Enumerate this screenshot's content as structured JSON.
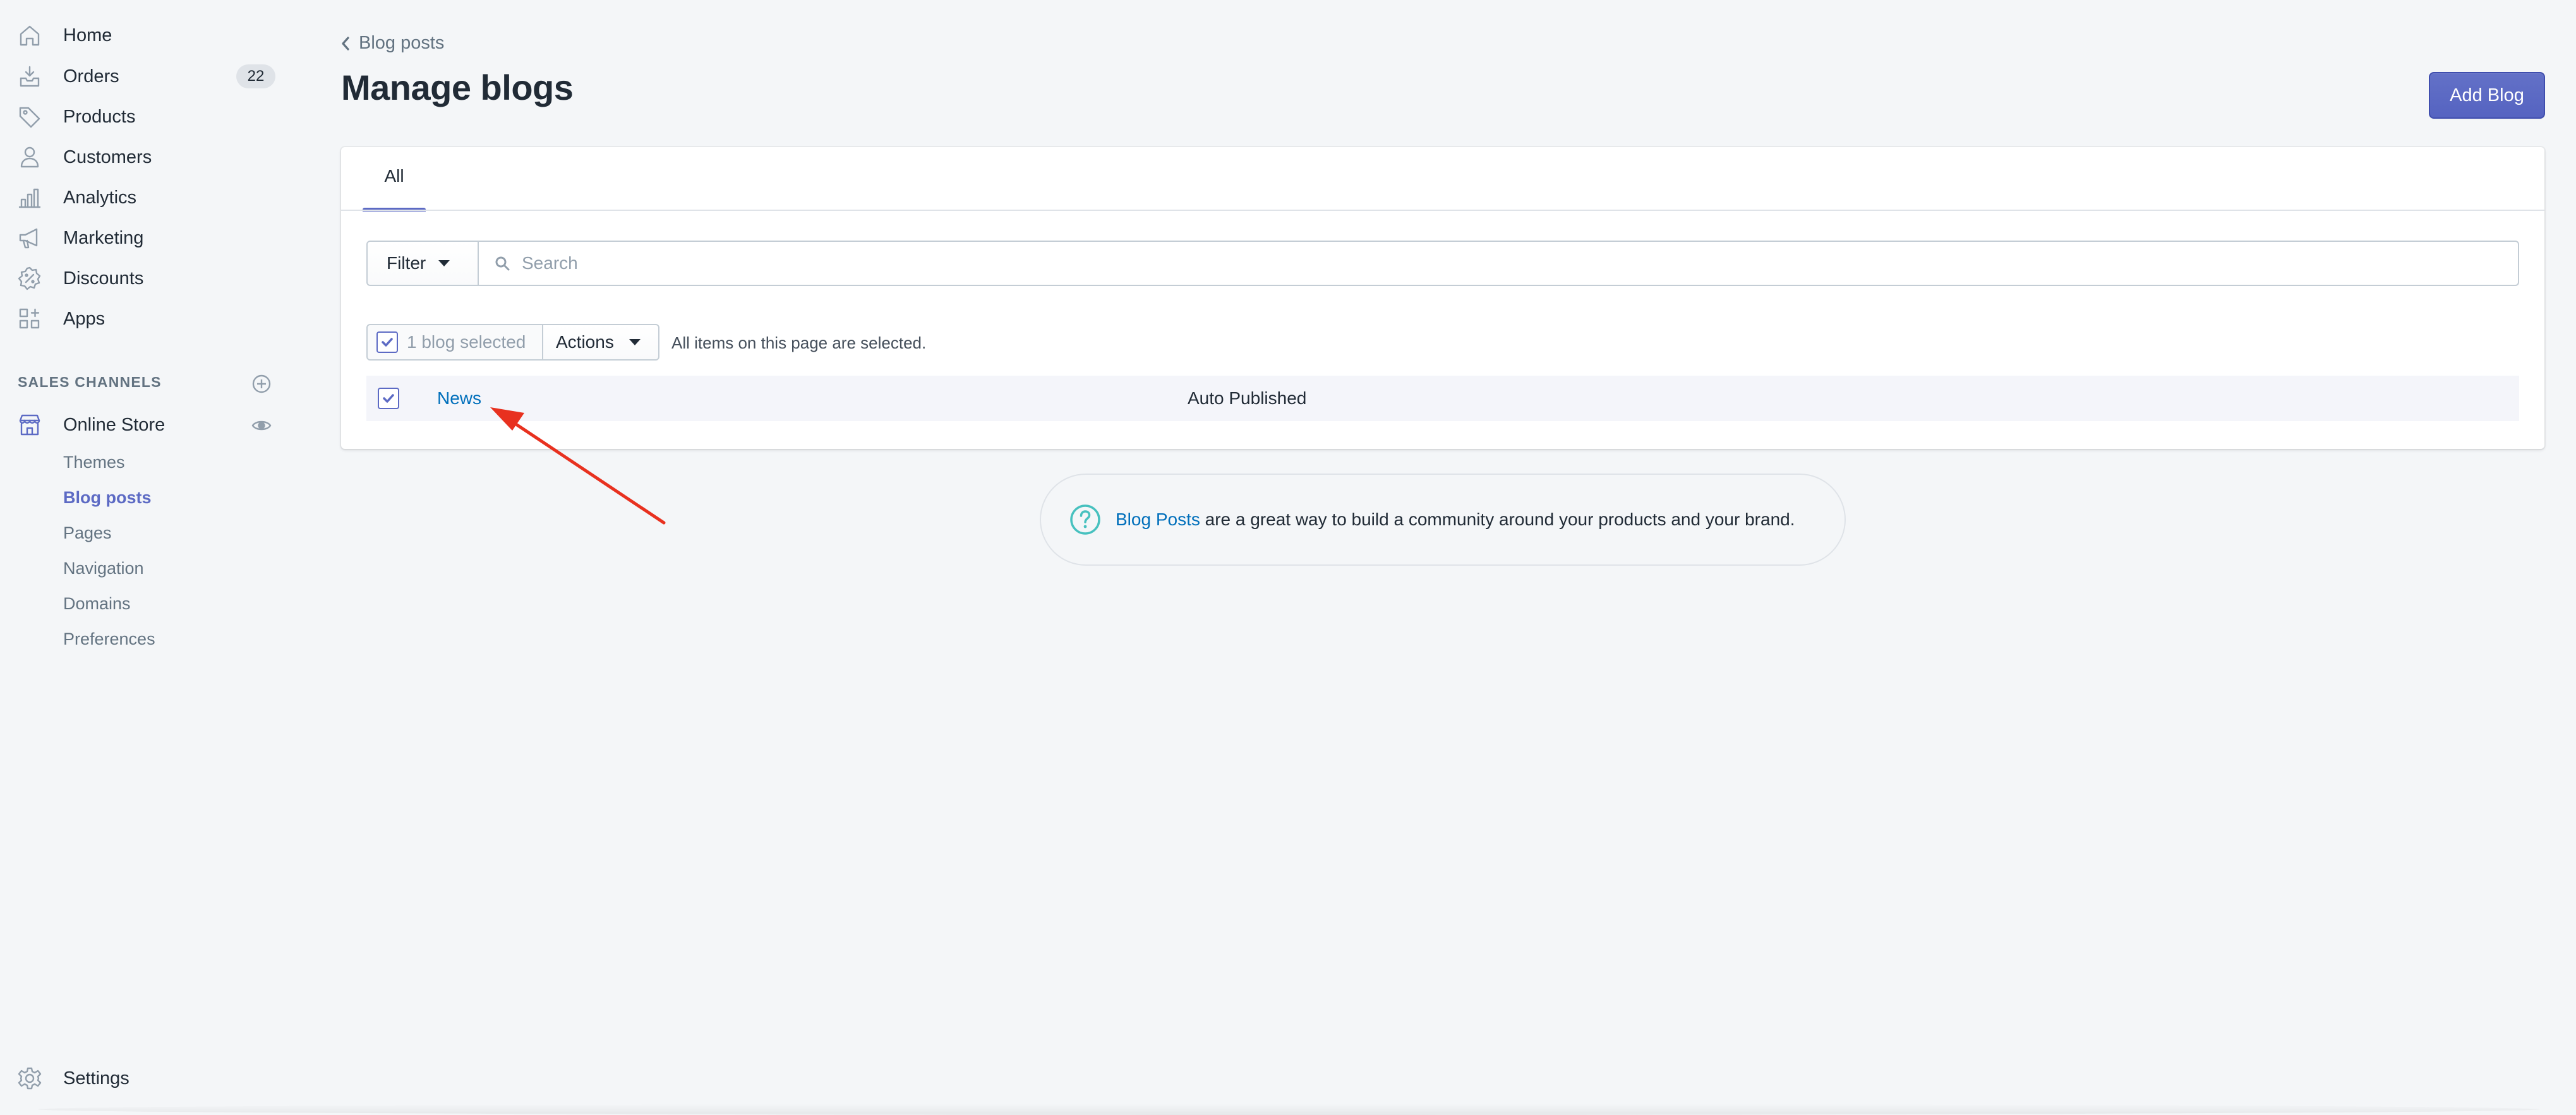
{
  "sidebar": {
    "nav": [
      {
        "label": "Home",
        "icon": "home-icon"
      },
      {
        "label": "Orders",
        "icon": "orders-icon",
        "badge": "22"
      },
      {
        "label": "Products",
        "icon": "tag-icon"
      },
      {
        "label": "Customers",
        "icon": "person-icon"
      },
      {
        "label": "Analytics",
        "icon": "bar-chart-icon"
      },
      {
        "label": "Marketing",
        "icon": "megaphone-icon"
      },
      {
        "label": "Discounts",
        "icon": "discount-icon"
      },
      {
        "label": "Apps",
        "icon": "apps-icon"
      }
    ],
    "sales_channels_heading": "SALES CHANNELS",
    "online_store": {
      "label": "Online Store",
      "icon": "store-icon"
    },
    "sub_items": [
      "Themes",
      "Blog posts",
      "Pages",
      "Navigation",
      "Domains",
      "Preferences"
    ],
    "active_sub_item": "Blog posts",
    "settings": {
      "label": "Settings",
      "icon": "gear-icon"
    }
  },
  "header": {
    "back_label": "Blog posts",
    "title": "Manage blogs",
    "primary_button": "Add Blog"
  },
  "tabs": [
    {
      "label": "All",
      "selected": true
    }
  ],
  "filter": {
    "label": "Filter",
    "search_placeholder": "Search"
  },
  "bulk": {
    "selected_text": "1 blog selected",
    "actions_label": "Actions",
    "all_selected_text": "All items on this page are selected."
  },
  "rows": [
    {
      "title": "News",
      "status": "Auto Published",
      "checked": true
    }
  ],
  "help": {
    "link": "Blog Posts",
    "text": " are a great way to build a community around your products and your brand."
  },
  "colors": {
    "accent": "#5c6ac4",
    "link": "#006fbb",
    "annotation_arrow": "#e8311f",
    "help_icon": "#47c1bf"
  }
}
